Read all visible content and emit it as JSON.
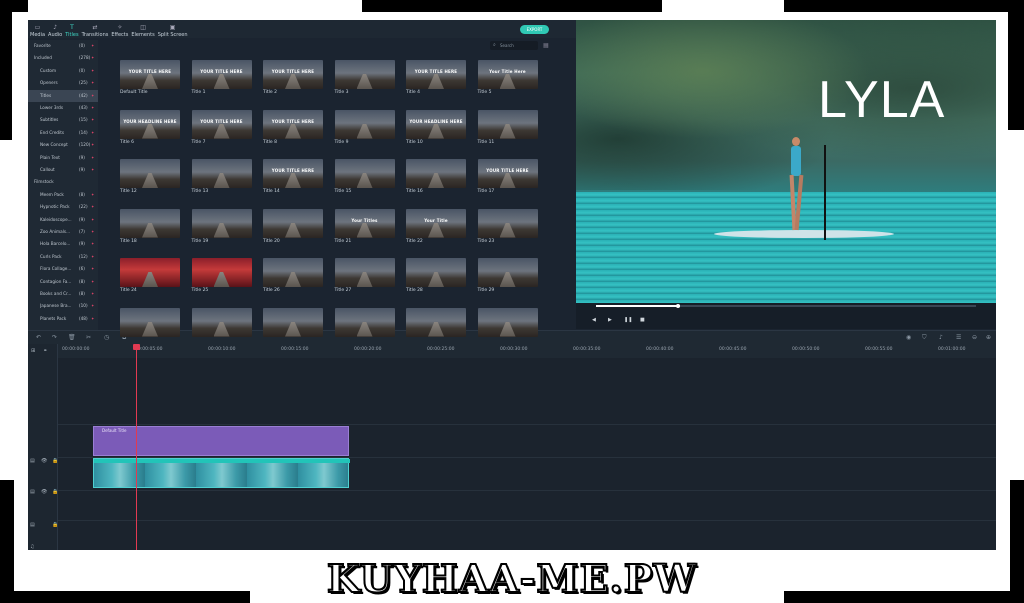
{
  "toolbar": {
    "tabs": [
      {
        "label": "Media",
        "icon": "folder-icon"
      },
      {
        "label": "Audio",
        "icon": "music-icon"
      },
      {
        "label": "Titles",
        "icon": "text-icon",
        "active": true
      },
      {
        "label": "Transitions",
        "icon": "transition-icon"
      },
      {
        "label": "Effects",
        "icon": "effects-icon"
      },
      {
        "label": "Elements",
        "icon": "elements-icon"
      },
      {
        "label": "Split Screen",
        "icon": "split-screen-icon"
      }
    ],
    "export_label": "EXPORT"
  },
  "sidebar": {
    "items": [
      {
        "label": "Favorite",
        "count": "(0)"
      },
      {
        "label": "Included",
        "count": "(278)"
      },
      {
        "label": "Custom",
        "count": "(0)"
      },
      {
        "label": "Openers",
        "count": "(25)"
      },
      {
        "label": "Titles",
        "count": "(42)"
      },
      {
        "label": "Lower 3rds",
        "count": "(43)"
      },
      {
        "label": "Subtitles",
        "count": "(15)"
      },
      {
        "label": "End Credits",
        "count": "(14)"
      },
      {
        "label": "New Concept",
        "count": "(120)"
      },
      {
        "label": "Plain Text",
        "count": "(9)"
      },
      {
        "label": "Callout",
        "count": "(9)"
      },
      {
        "label": "Filmstock",
        "count": ""
      },
      {
        "label": "Meem Pack",
        "count": "(8)"
      },
      {
        "label": "Hypnotic Pack",
        "count": "(22)"
      },
      {
        "label": "Kaleidoscope...",
        "count": "(9)"
      },
      {
        "label": "Zoo Animals...",
        "count": "(7)"
      },
      {
        "label": "Hola Barcelo...",
        "count": "(9)"
      },
      {
        "label": "Curls Pack",
        "count": "(12)"
      },
      {
        "label": "Flora Collage...",
        "count": "(6)"
      },
      {
        "label": "Contagion Fa...",
        "count": "(8)"
      },
      {
        "label": "Books and Cr...",
        "count": "(8)"
      },
      {
        "label": "Japanese Bra...",
        "count": "(10)"
      },
      {
        "label": "Planets Pack",
        "count": "(48)"
      }
    ]
  },
  "search": {
    "placeholder": "Search"
  },
  "grid": {
    "titles": [
      {
        "caption": "Default Title",
        "text": "YOUR TITLE HERE"
      },
      {
        "caption": "Title 1",
        "text": "YOUR TITLE HERE"
      },
      {
        "caption": "Title 2",
        "text": "YOUR TITLE HERE"
      },
      {
        "caption": "Title 3",
        "text": ""
      },
      {
        "caption": "Title 4",
        "text": "YOUR TITLE HERE"
      },
      {
        "caption": "Title 5",
        "text": "Your Title Here"
      },
      {
        "caption": "Title 6",
        "text": "YOUR HEADLINE HERE"
      },
      {
        "caption": "Title 7",
        "text": "YOUR TITLE HERE"
      },
      {
        "caption": "Title 8",
        "text": "YOUR TITLE HERE"
      },
      {
        "caption": "Title 9",
        "text": ""
      },
      {
        "caption": "Title 10",
        "text": "YOUR HEADLINE HERE"
      },
      {
        "caption": "Title 11",
        "text": ""
      },
      {
        "caption": "Title 12",
        "text": ""
      },
      {
        "caption": "Title 13",
        "text": ""
      },
      {
        "caption": "Title 14",
        "text": "YOUR TITLE HERE"
      },
      {
        "caption": "Title 15",
        "text": ""
      },
      {
        "caption": "Title 16",
        "text": ""
      },
      {
        "caption": "Title 17",
        "text": "YOUR TITLE HERE"
      },
      {
        "caption": "Title 18",
        "text": ""
      },
      {
        "caption": "Title 19",
        "text": ""
      },
      {
        "caption": "Title 20",
        "text": ""
      },
      {
        "caption": "Title 21",
        "text": "Your Titles"
      },
      {
        "caption": "Title 22",
        "text": "Your Title"
      },
      {
        "caption": "Title 23",
        "text": ""
      },
      {
        "caption": "Title 24",
        "text": ""
      },
      {
        "caption": "Title 25",
        "text": ""
      },
      {
        "caption": "Title 26",
        "text": ""
      },
      {
        "caption": "Title 27",
        "text": ""
      },
      {
        "caption": "Title 28",
        "text": ""
      },
      {
        "caption": "Title 29",
        "text": ""
      },
      {
        "caption": "",
        "text": ""
      },
      {
        "caption": "",
        "text": ""
      },
      {
        "caption": "",
        "text": ""
      },
      {
        "caption": "",
        "text": ""
      },
      {
        "caption": "",
        "text": ""
      },
      {
        "caption": "",
        "text": ""
      }
    ]
  },
  "preview": {
    "overlay_text": "LYLA",
    "progress": 0.22
  },
  "timeline": {
    "ticks": [
      "00:00:00:00",
      "00:00:05:00",
      "00:00:10:00",
      "00:00:15:00",
      "00:00:20:00",
      "00:00:25:00",
      "00:00:30:00",
      "00:00:35:00",
      "00:00:40:00",
      "00:00:45:00",
      "00:00:50:00",
      "00:00:55:00",
      "00:01:00:00"
    ],
    "title_clip": "Default Title"
  },
  "watermark": "KUYHAA-ME.PW"
}
